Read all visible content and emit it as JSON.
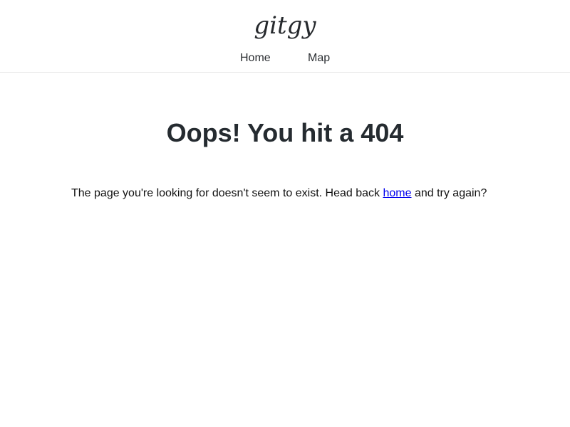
{
  "header": {
    "logo_text": "gitgy",
    "nav": [
      {
        "label": "Home"
      },
      {
        "label": "Map"
      }
    ]
  },
  "main": {
    "title": "Oops! You hit a 404",
    "message_before": "The page you're looking for doesn't seem to exist. Head back ",
    "message_link": "home",
    "message_after": " and try again?"
  },
  "colors": {
    "text_dark": "#252b30",
    "link": "#0000ee",
    "divider": "#e6e6e6"
  }
}
